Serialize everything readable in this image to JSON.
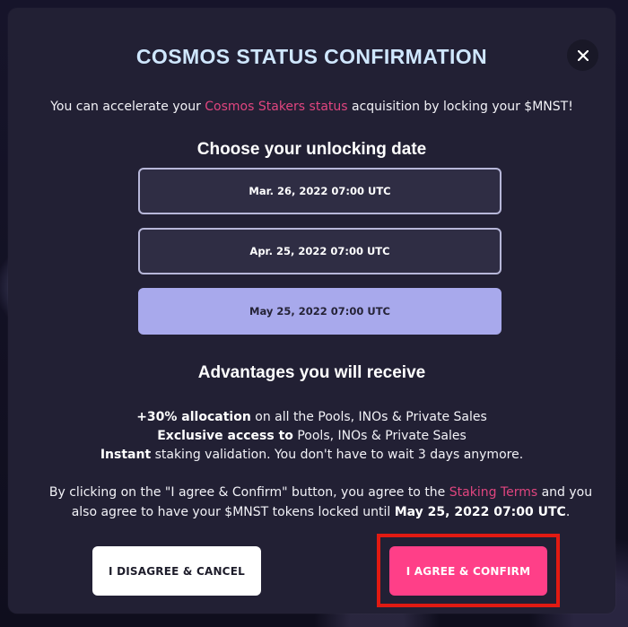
{
  "modal": {
    "title": "COSMOS STATUS CONFIRMATION",
    "close_icon": "close-icon"
  },
  "intro": {
    "before": "You can accelerate your ",
    "link": "Cosmos Stakers status",
    "after": " acquisition by locking your $MNST!"
  },
  "unlock_section": {
    "heading": "Choose your unlocking date",
    "options": [
      {
        "label": "Mar. 26, 2022 07:00 UTC",
        "selected": false
      },
      {
        "label": "Apr. 25, 2022 07:00 UTC",
        "selected": false
      },
      {
        "label": "May 25, 2022 07:00 UTC",
        "selected": true
      }
    ]
  },
  "advantages": {
    "heading": "Advantages you will receive",
    "items": [
      {
        "strong": "+30% allocation",
        "text": " on all the Pools, INOs & Private Sales"
      },
      {
        "strong": "Exclusive access to",
        "text": " Pools, INOs & Private Sales"
      },
      {
        "strong": "Instant",
        "text": " staking validation. You don't have to wait 3 days anymore."
      }
    ]
  },
  "terms": {
    "part1": "By clicking on the \"I agree & Confirm\" button, you agree to the ",
    "link": "Staking Terms",
    "part2": " and you also agree to have your $MNST tokens locked until ",
    "date": "May 25, 2022 07:00 UTC",
    "part3": "."
  },
  "buttons": {
    "cancel_label": "I DISAGREE & CANCEL",
    "confirm_label": "I AGREE & CONFIRM"
  },
  "colors": {
    "modal_bg": "#222034",
    "title": "#cfe7ff",
    "accent_pink": "#e0457f",
    "confirm_button": "#ff3f88",
    "selected_option": "#a8a9ec",
    "highlight_border": "#e11a12"
  }
}
